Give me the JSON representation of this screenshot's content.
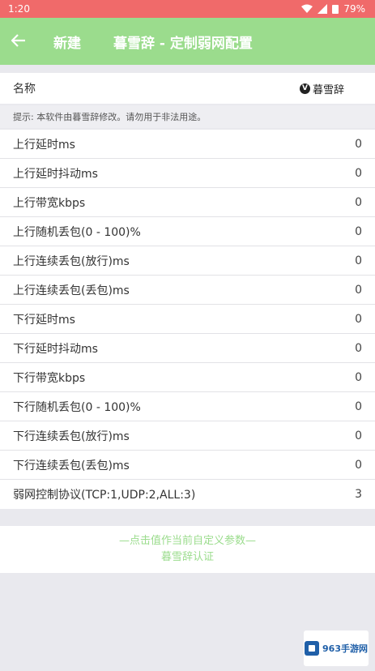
{
  "status": {
    "time": "1:20",
    "battery": "79%"
  },
  "appbar": {
    "back_icon": "arrow-left-icon",
    "new_label": "新建",
    "title": "暮雪辞 - 定制弱网配置"
  },
  "name_row": {
    "label": "名称",
    "author_badge": "V",
    "author": "暮雪辞"
  },
  "hint": "提示: 本软件由暮雪辞修改。请勿用于非法用途。",
  "rows": [
    {
      "label": "上行延时ms",
      "value": "0"
    },
    {
      "label": "上行延时抖动ms",
      "value": "0"
    },
    {
      "label": "上行带宽kbps",
      "value": "0"
    },
    {
      "label": "上行随机丢包(0 - 100)%",
      "value": "0"
    },
    {
      "label": "上行连续丢包(放行)ms",
      "value": "0"
    },
    {
      "label": "上行连续丢包(丢包)ms",
      "value": "0"
    },
    {
      "label": "下行延时ms",
      "value": "0"
    },
    {
      "label": "下行延时抖动ms",
      "value": "0"
    },
    {
      "label": "下行带宽kbps",
      "value": "0"
    },
    {
      "label": "下行随机丢包(0 - 100)%",
      "value": "0"
    },
    {
      "label": "下行连续丢包(放行)ms",
      "value": "0"
    },
    {
      "label": "下行连续丢包(丢包)ms",
      "value": "0"
    },
    {
      "label": "弱网控制协议(TCP:1,UDP:2,ALL:3)",
      "value": "3"
    }
  ],
  "footer": {
    "line1": "—点击值作当前自定义参数—",
    "line2": "暮雪辞认证"
  },
  "watermark": {
    "text": "963手游网"
  },
  "colors": {
    "status_bar": "#f06a6a",
    "app_bar": "#9bdc8d",
    "footer_text": "#9bdc8d"
  }
}
